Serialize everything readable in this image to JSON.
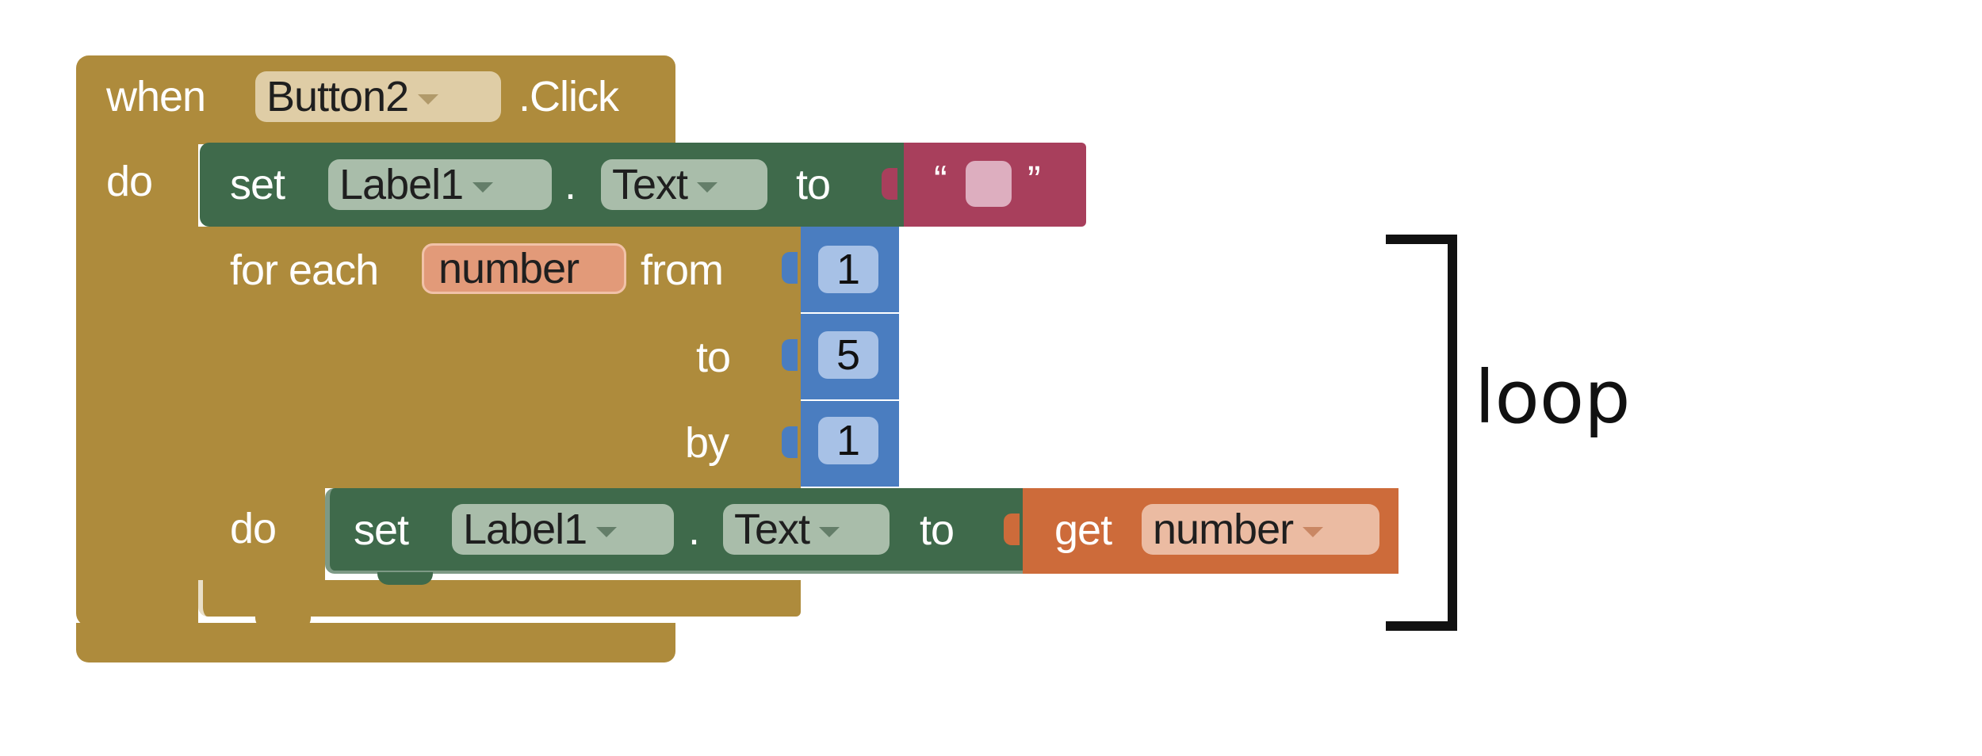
{
  "event": {
    "when_label": "when",
    "component": "Button2",
    "event_name": ".Click",
    "do_label": "do"
  },
  "first_set": {
    "set_label": "set",
    "component": "Label1",
    "dot": ".",
    "property": "Text",
    "to_label": "to",
    "text_open_quote": "“",
    "text_close_quote": "”"
  },
  "for_each": {
    "for_each_label": "for each",
    "variable": "number",
    "from_label": "from",
    "from_value": "1",
    "to_label": "to",
    "to_value": "5",
    "by_label": "by",
    "by_value": "1",
    "do_label": "do"
  },
  "inner_set": {
    "set_label": "set",
    "component": "Label1",
    "dot": ".",
    "property": "Text",
    "to_label": "to",
    "get_label": "get",
    "variable": "number"
  },
  "annotation": {
    "label": "loop"
  },
  "colors": {
    "control": "#ae8b3c",
    "setter": "#3f6a4b",
    "math": "#4a7dc0",
    "variable": "#cd6b3a",
    "text": "#a83f5c"
  },
  "icons": [
    "dropdown-caret-icon",
    "bracket-icon"
  ]
}
